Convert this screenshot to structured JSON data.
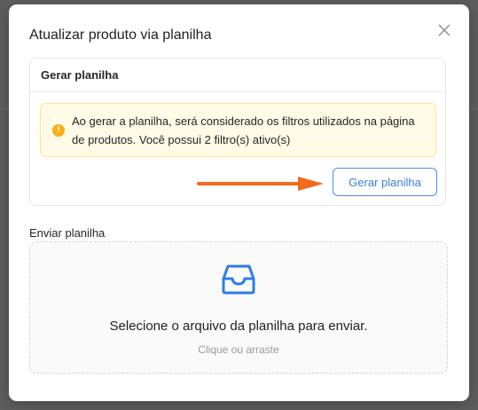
{
  "modal": {
    "title": "Atualizar produto via planilha",
    "close_icon": "close-icon"
  },
  "generate_section": {
    "title": "Gerar planilha",
    "alert_icon": "exclamation-circle-icon",
    "alert_text": "Ao gerar a planilha, será considerado os filtros utilizados na página de produtos. Você possui 2 filtro(s) ativo(s)",
    "button_label": "Gerar planilha",
    "annotation_arrow_color": "#f26a1b"
  },
  "upload_section": {
    "label": "Enviar planilha",
    "icon": "inbox-icon",
    "main_text": "Selecione o arquivo da planilha para enviar.",
    "hint_text": "Clique ou arraste"
  },
  "colors": {
    "primary": "#3a7fd6",
    "warning": "#faad14",
    "warning_bg": "#fffbe6"
  }
}
